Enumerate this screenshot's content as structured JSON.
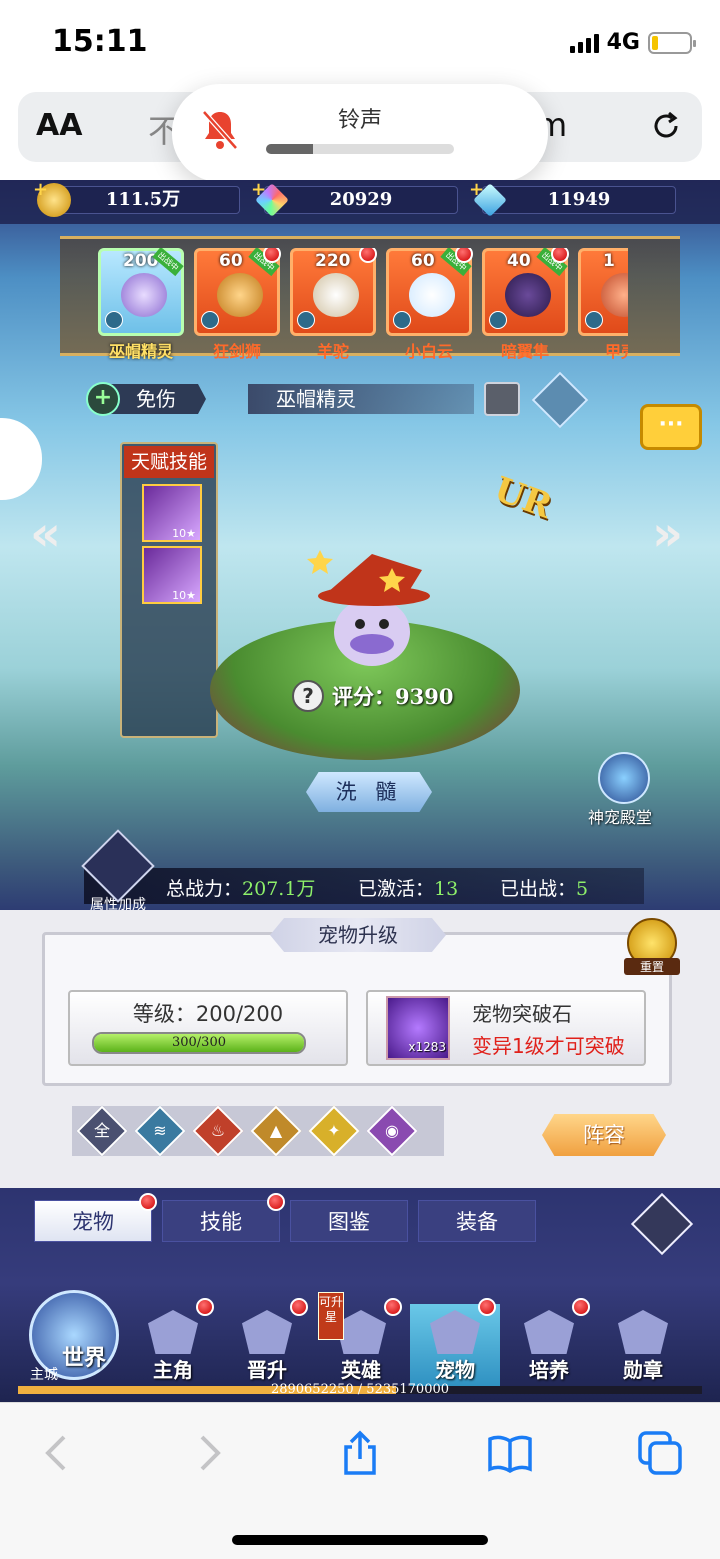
{
  "status_bar": {
    "time": "15:11",
    "network": "4G",
    "battery_level": 0.18
  },
  "browser": {
    "aa_label": "AA",
    "url_prefix": "不",
    "url_suffix": "m",
    "reload_icon": "reload-icon"
  },
  "ringer": {
    "label": "铃声",
    "level": 0.25,
    "icon": "bell-slash-icon"
  },
  "resources": [
    {
      "icon": "gold-coin-icon",
      "value": "111.5万",
      "color": "#f5c842"
    },
    {
      "icon": "rainbow-gem-icon",
      "value": "20929",
      "color": "#c07aff"
    },
    {
      "icon": "blue-diamond-icon",
      "value": "11949",
      "color": "#5fd0ff"
    }
  ],
  "pets": [
    {
      "name": "巫帽精灵",
      "level": "200",
      "tag": "出战中",
      "active": true,
      "color": "#b8e8ff"
    },
    {
      "name": "狂剑狮",
      "level": "60",
      "tag": "出战中",
      "active": false,
      "color": "#ff7a3a"
    },
    {
      "name": "羊驼",
      "level": "220",
      "tag": "",
      "active": false,
      "color": "#ff7a3a"
    },
    {
      "name": "小白云",
      "level": "60",
      "tag": "出战中",
      "active": false,
      "color": "#ff7a3a"
    },
    {
      "name": "暗翼隼",
      "level": "40",
      "tag": "出战中",
      "active": false,
      "color": "#ff7a3a"
    },
    {
      "name": "甲壳",
      "level": "1",
      "tag": "",
      "active": false,
      "color": "#ff7a3a"
    }
  ],
  "trait": {
    "icon": "plus-shield-icon",
    "label": "免伤"
  },
  "pet_name": "巫帽精灵",
  "rarity": "UR",
  "talent": {
    "title": "天赋技能",
    "skills": [
      {
        "level": "10★"
      },
      {
        "level": "10★"
      }
    ]
  },
  "score": {
    "label": "评分：",
    "value": "9390"
  },
  "wash_button": "洗 髓",
  "temple_label": "神宠殿堂",
  "attr_label": "属性加成",
  "stats": {
    "power_label": "总战力：",
    "power_value": "207.1万",
    "activated_label": "已激活：",
    "activated_value": "13",
    "deployed_label": "已出战：",
    "deployed_value": "5"
  },
  "upgrade": {
    "title": "宠物升级",
    "reset_label": "重置",
    "level_label": "等级：200/200",
    "exp_text": "300/300",
    "exp_fraction": 1.0,
    "stone_name": "宠物突破石",
    "stone_count": "x1283",
    "stone_warning": "变异1级才可突破"
  },
  "element_filters": [
    {
      "label": "全",
      "color": "#4a5070"
    },
    {
      "label": "",
      "color": "#3a7aa0",
      "icon": "water-icon"
    },
    {
      "label": "",
      "color": "#c0402a",
      "icon": "fire-icon"
    },
    {
      "label": "",
      "color": "#c08a2a",
      "icon": "earth-icon"
    },
    {
      "label": "",
      "color": "#d8b02a",
      "icon": "light-icon"
    },
    {
      "label": "",
      "color": "#8a4ab0",
      "icon": "dark-icon"
    }
  ],
  "lineup_button": "阵容",
  "tabs": [
    {
      "label": "宠物",
      "active": true,
      "dot": true
    },
    {
      "label": "技能",
      "active": false,
      "dot": true
    },
    {
      "label": "图鉴",
      "active": false,
      "dot": false
    },
    {
      "label": "装备",
      "active": false,
      "dot": false
    }
  ],
  "main_nav": {
    "world_label": "世界",
    "city_label": "主城",
    "upgradable_badge": "可升星",
    "items": [
      {
        "label": "主角",
        "dot": true,
        "active": false
      },
      {
        "label": "晋升",
        "dot": true,
        "active": false
      },
      {
        "label": "英雄",
        "dot": true,
        "active": false
      },
      {
        "label": "宠物",
        "dot": true,
        "active": true
      },
      {
        "label": "培养",
        "dot": true,
        "active": false
      },
      {
        "label": "勋章",
        "dot": false,
        "active": false
      }
    ],
    "exp_text": "2890652250 / 5235170000",
    "exp_fraction": 0.552
  },
  "toolbar": [
    "back-icon",
    "forward-icon",
    "share-icon",
    "bookmarks-icon",
    "tabs-icon"
  ]
}
